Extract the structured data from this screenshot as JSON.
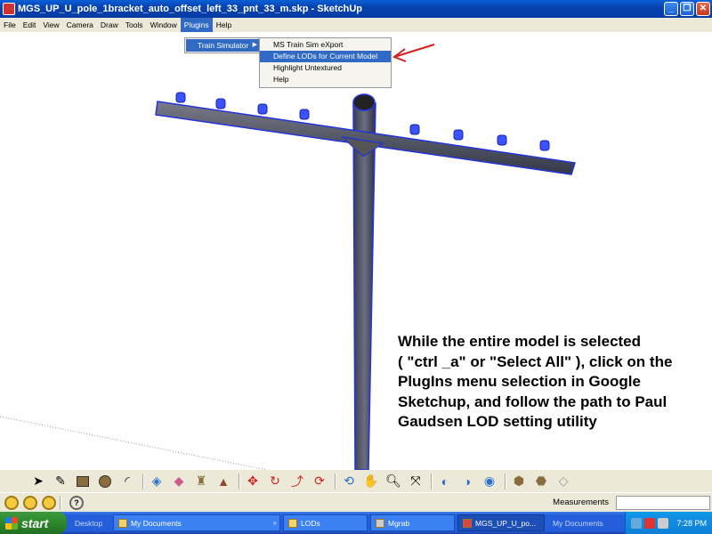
{
  "window": {
    "title": "MGS_UP_U_pole_1bracket_auto_offset_left_33_pnt_33_m.skp - SketchUp",
    "minimize": "_",
    "maximize": "❐",
    "close": "✕"
  },
  "menubar": {
    "items": [
      "File",
      "Edit",
      "View",
      "Camera",
      "Draw",
      "Tools",
      "Window",
      "Plugins",
      "Help"
    ],
    "active": "Plugins"
  },
  "plugins_menu": {
    "item": "Train Simulator",
    "arrow": "▶"
  },
  "train_sim_menu": {
    "items": [
      "MS Train Sim eXport",
      "Define LODs for Current Model",
      "Highlight Untextured",
      "Help"
    ],
    "highlighted": "Define LODs for Current Model"
  },
  "annotation": {
    "lines": [
      "While the entire model is selected",
      "( \"ctrl _a\" or \"Select All\" ), click on the",
      "PlugIns menu selection in Google",
      "Sketchup, and follow the path to Paul",
      "Gaudsen LOD setting utility"
    ],
    "arrow_color": "#d42020"
  },
  "toolbar": {
    "tools": [
      "select-icon",
      "pencil-icon",
      "rectangle-icon",
      "circle-icon",
      "arc-icon",
      "make-component-icon",
      "eraser-icon",
      "paint-bucket-icon",
      "push-pull-icon",
      "move-icon",
      "rotate-icon",
      "follow-me-icon",
      "offset-icon",
      "orbit-icon",
      "pan-icon",
      "zoom-icon",
      "zoom-extents-icon",
      "previous-view-icon",
      "next-view-icon",
      "get-models-icon",
      "share-model-icon",
      "components-icon",
      "extension-icon"
    ]
  },
  "statusbar": {
    "measurements_label": "Measurements",
    "measurements_value": ""
  },
  "taskbar": {
    "start_label": "start",
    "tasks": [
      {
        "label": "Desktop",
        "style": "dim"
      },
      {
        "label": "My Documents",
        "style": "normal"
      },
      {
        "label": "LODs",
        "style": "normal"
      },
      {
        "label": "Mgrab",
        "style": "normal"
      },
      {
        "label": "MGS_UP_U_po...",
        "style": "active"
      },
      {
        "label": "My Documents",
        "style": "dim"
      }
    ],
    "clock": "7:28 PM"
  },
  "colors": {
    "selection_blue": "#2233dd",
    "menu_highlight": "#316ac5",
    "xp_blue": "#245edb",
    "start_green": "#2e8b2e"
  }
}
